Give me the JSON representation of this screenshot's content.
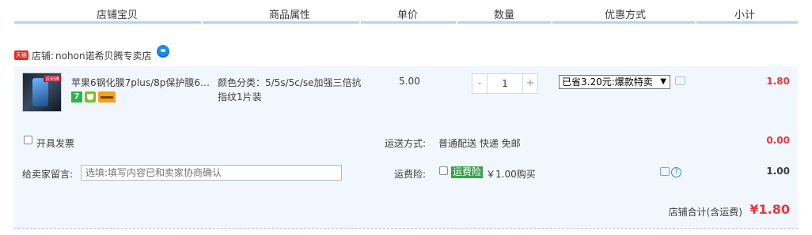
{
  "header": {
    "col_shop": "店铺宝贝",
    "col_attr": "商品属性",
    "col_price": "单价",
    "col_qty": "数量",
    "col_promo": "优惠方式",
    "col_subtotal": "小计"
  },
  "shop": {
    "badge": "天猫",
    "label": "店铺:",
    "name": "nohon诺希贝腾专卖店"
  },
  "item": {
    "thumb_label": "送贴膜",
    "title": "苹果6钢化膜7plus/8p保护膜6s/...",
    "badge_7": "7",
    "attr": "颜色分类：5/5s/5c/se加强三倍抗指纹1片装",
    "unit_price": "5.00",
    "qty_minus": "-",
    "qty_value": "1",
    "qty_plus": "+",
    "promo": "已省3.20元:爆款特卖",
    "promo_arrow": "▼",
    "subtotal": "1.80"
  },
  "invoice": {
    "label": "开具发票",
    "shipping_label": "运送方式:",
    "shipping_value": "普通配送 快递 免邮",
    "shipping_fee": "0.00"
  },
  "message": {
    "label": "给卖家留言:",
    "placeholder": "选填:填写内容已和卖家协商确认",
    "insurance_label": "运费险:",
    "insurance_tag": "运费险",
    "insurance_price": "￥1.00购买",
    "help": "?",
    "insurance_value": "1.00"
  },
  "total": {
    "label": "店铺合计(含运费)",
    "amount": "¥1.80"
  },
  "colors": {
    "accent_red": "#e4393c",
    "row_bg": "#f2f7ff",
    "header_underline": "#b2d1ff"
  }
}
